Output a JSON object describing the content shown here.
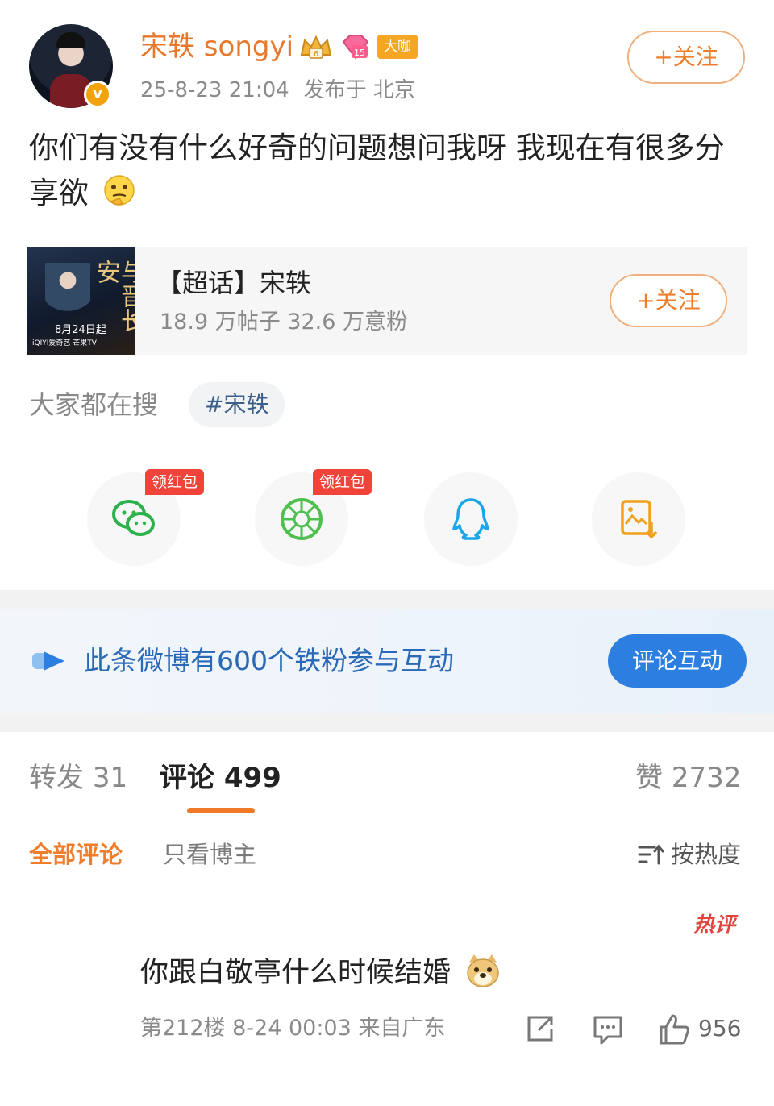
{
  "post": {
    "username": "宋轶 songyi",
    "badge_daka": "大咖",
    "timestamp": "25-8-23 21:04",
    "location": "发布于 北京",
    "follow_label": "+关注",
    "text": "你们有没有什么好奇的问题想问我呀 我现在有很多分享欲"
  },
  "topic_card": {
    "name": "【超话】宋轶",
    "stats": "18.9 万帖子 32.6 万意粉",
    "follow_label": "+关注",
    "thumb_title": "与晋长安",
    "thumb_date": "8月24日起",
    "thumb_logos": "iQIYI爱奇艺 芒果TV"
  },
  "search": {
    "label": "大家都在搜",
    "tag": "#宋轶"
  },
  "share": {
    "red_badge_label": "领红包",
    "items": [
      "wechat-icon",
      "moments-icon",
      "qq-icon",
      "save-image-icon"
    ]
  },
  "banner": {
    "text": "此条微博有600个铁粉参与互动",
    "button": "评论互动"
  },
  "tabs": {
    "repost_label": "转发",
    "repost_count": "31",
    "comment_label": "评论",
    "comment_count": "499",
    "like_label": "赞",
    "like_count": "2732"
  },
  "filters": {
    "all": "全部评论",
    "author_only": "只看博主",
    "sort": "按热度"
  },
  "comment": {
    "hot_tag": "热评",
    "text": "你跟白敬亭什么时候结婚",
    "meta": "第212楼 8-24 00:03 来自广东",
    "likes": "956"
  },
  "colors": {
    "accent_orange": "#ef7d2b",
    "link_blue": "#2a68b8",
    "button_blue": "#2c7fe0",
    "hot_red": "#e0443a"
  }
}
